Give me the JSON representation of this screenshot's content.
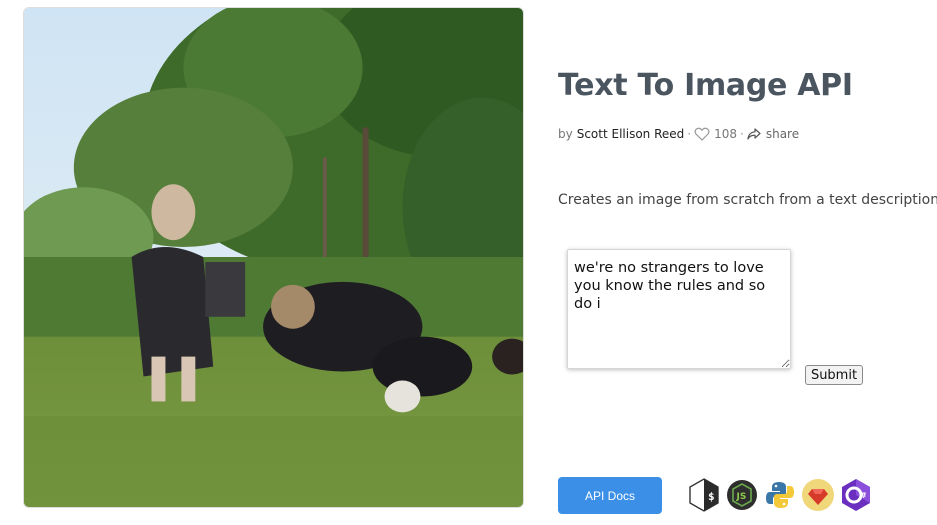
{
  "title": "Text To Image API",
  "meta": {
    "by": "by",
    "author": "Scott Ellison Reed",
    "sep": "·",
    "likes": "108",
    "share": "share"
  },
  "description": "Creates an image from scratch from a text description.",
  "prompt": {
    "value": "we're no strangers to love you know the rules and so do i"
  },
  "submit_label": "Submit",
  "api_docs_label": "API Docs",
  "colors": {
    "title": "#4a5560",
    "accent": "#3b8fe6"
  },
  "language_icons": [
    "bash-icon",
    "nodejs-icon",
    "python-icon",
    "ruby-icon",
    "csharp-icon"
  ]
}
